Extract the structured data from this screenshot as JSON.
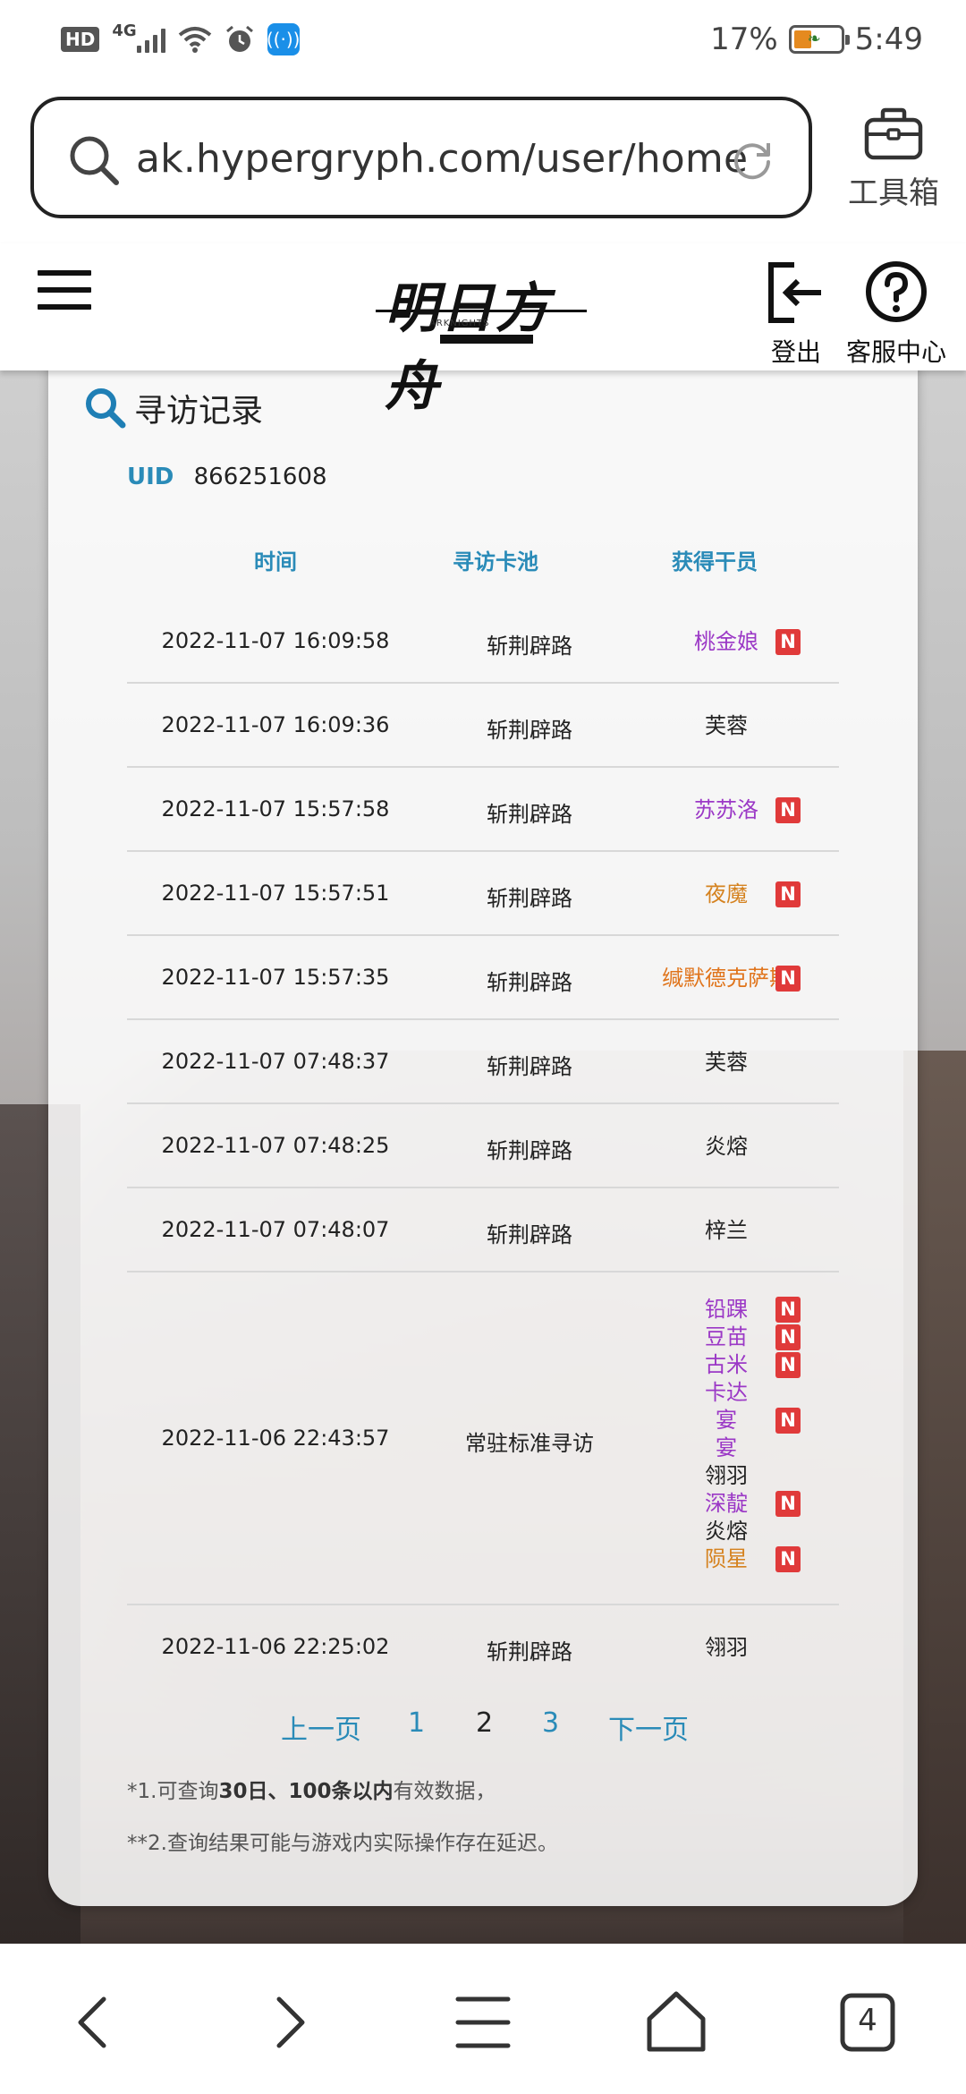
{
  "status_bar": {
    "hd": "HD",
    "net": "4G",
    "battery": "17%",
    "time": "5:49"
  },
  "browser": {
    "url": "ak.hypergryph.com/user/home",
    "toolbox_label": "工具箱"
  },
  "site": {
    "logo_text": "明日方舟",
    "logo_sub": "ARKNIGHTS",
    "logout_label": "登出",
    "help_label": "客服中心"
  },
  "card": {
    "title": "寻访记录",
    "uid_label": "UID",
    "uid_value": "866251608",
    "columns": {
      "time": "时间",
      "pool": "寻访卡池",
      "operator": "获得干员"
    },
    "rows": [
      {
        "time": "2022-11-07 16:09:58",
        "pool": "斩荆辟路",
        "ops": [
          {
            "name": "桃金娘",
            "new": "N"
          }
        ]
      },
      {
        "time": "2022-11-07 16:09:36",
        "pool": "斩荆辟路",
        "ops": [
          {
            "name": "芙蓉",
            "new": ""
          }
        ]
      },
      {
        "time": "2022-11-07 15:57:58",
        "pool": "斩荆辟路",
        "ops": [
          {
            "name": "苏苏洛",
            "new": "N"
          }
        ]
      },
      {
        "time": "2022-11-07 15:57:51",
        "pool": "斩荆辟路",
        "ops": [
          {
            "name": "夜魔",
            "new": "N"
          }
        ]
      },
      {
        "time": "2022-11-07 15:57:35",
        "pool": "斩荆辟路",
        "ops": [
          {
            "name": "缄默德克萨斯",
            "new": "N"
          }
        ]
      },
      {
        "time": "2022-11-07 07:48:37",
        "pool": "斩荆辟路",
        "ops": [
          {
            "name": "芙蓉",
            "new": ""
          }
        ]
      },
      {
        "time": "2022-11-07 07:48:25",
        "pool": "斩荆辟路",
        "ops": [
          {
            "name": "炎熔",
            "new": ""
          }
        ]
      },
      {
        "time": "2022-11-07 07:48:07",
        "pool": "斩荆辟路",
        "ops": [
          {
            "name": "梓兰",
            "new": ""
          }
        ]
      },
      {
        "time": "2022-11-06 22:43:57",
        "pool": "常驻标准寻访",
        "ops": [
          {
            "name": "铅踝",
            "new": "N"
          },
          {
            "name": "豆苗",
            "new": "N"
          },
          {
            "name": "古米",
            "new": "N"
          },
          {
            "name": "卡达",
            "new": ""
          },
          {
            "name": "宴",
            "new": "N"
          },
          {
            "name": "宴",
            "new": ""
          },
          {
            "name": "翎羽",
            "new": ""
          },
          {
            "name": "深靛",
            "new": "N"
          },
          {
            "name": "炎熔",
            "new": ""
          },
          {
            "name": "陨星",
            "new": "N"
          }
        ]
      },
      {
        "time": "2022-11-06 22:25:02",
        "pool": "斩荆辟路",
        "ops": [
          {
            "name": "翎羽",
            "new": ""
          }
        ]
      }
    ],
    "pager": {
      "prev": "上一页",
      "p1": "1",
      "p2": "2",
      "p3": "3",
      "next": "下一页"
    },
    "note1": {
      "a": "*1.可查询",
      "b": "30日、100条以内",
      "c": "有效数据，"
    },
    "note2": "**2.查询结果可能与游戏内实际操作存在延迟。"
  },
  "nav": {
    "tabs_count": "4"
  },
  "colors": {
    "accent": "#2a8bb8",
    "rarity_4": "#9b38c6",
    "rarity_5": "#d5821f",
    "new_badge": "#e03a3a"
  }
}
